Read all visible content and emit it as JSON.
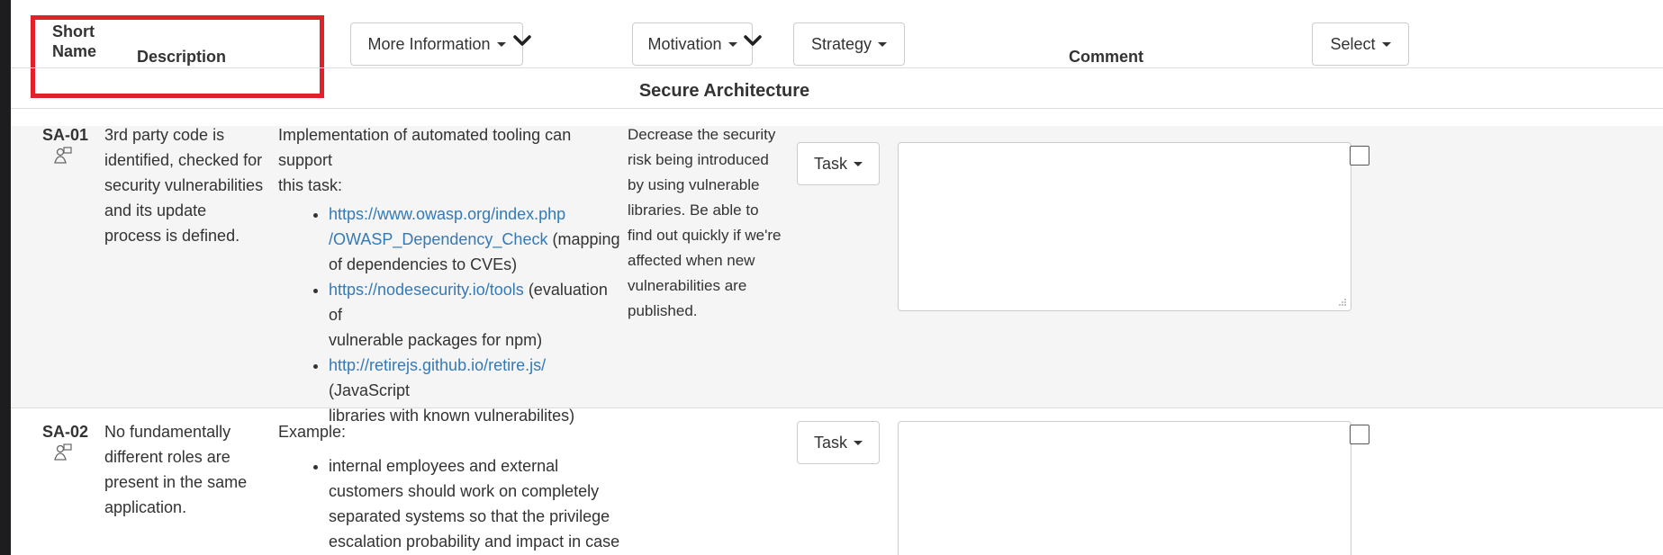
{
  "header": {
    "short_name": "Short Name",
    "short_name_line1": "Short",
    "short_name_line2": "Name",
    "description": "Description",
    "more_information": "More Information",
    "motivation": "Motivation",
    "strategy": "Strategy",
    "comment": "Comment",
    "select": "Select"
  },
  "section": {
    "title": "Secure Architecture"
  },
  "rows": [
    {
      "code": "SA-01",
      "description": "3rd party code is identified, checked for security vulnerabilities and its update process is defined.",
      "desc_lines": [
        "3rd party code is",
        "identified, checked for",
        "security vulnerabilities",
        "and its update",
        "process is defined."
      ],
      "info_intro_lines": [
        "Implementation of automated tooling can support",
        "this task:"
      ],
      "links": [
        {
          "url_lines": [
            "https://www.owasp.org/index.php",
            "/OWASP_Dependency_Check"
          ],
          "note_inline": "(mapping",
          "note_lines": [
            "of dependencies to CVEs)"
          ]
        },
        {
          "url_lines": [
            "https://nodesecurity.io/tools"
          ],
          "note_inline": "(evaluation of",
          "note_lines": [
            "vulnerable packages for npm)"
          ]
        },
        {
          "url_lines": [
            "http://retirejs.github.io/retire.js/"
          ],
          "note_inline": "(JavaScript",
          "note_lines": [
            "libraries with known vulnerabilites)"
          ]
        }
      ],
      "motivation_lines": [
        "Decrease the security",
        "risk being introduced",
        "by using vulnerable",
        "libraries. Be able to",
        "find out quickly if we're",
        "affected when new",
        "vulnerabilities are",
        "published."
      ],
      "task_label": "Task",
      "comment_value": "",
      "checked": false
    },
    {
      "code": "SA-02",
      "desc_lines": [
        "No fundamentally",
        "different roles are",
        "present in the same",
        "application."
      ],
      "info_intro_lines": [
        "Example:"
      ],
      "bullet_lines": [
        "internal employees and external",
        "customers should work on completely",
        "separated systems so that the privilege",
        "escalation probability and impact in case"
      ],
      "task_label": "Task",
      "comment_value": "",
      "checked": false
    }
  ],
  "icons": {
    "dropdown": "caret-down-icon",
    "expand": "chevron-down-icon",
    "role": "role-person-icon"
  },
  "colors": {
    "highlight": "#e0202b",
    "link": "#337ab7",
    "row_bg": "#f5f5f5",
    "border": "#cccccc"
  }
}
